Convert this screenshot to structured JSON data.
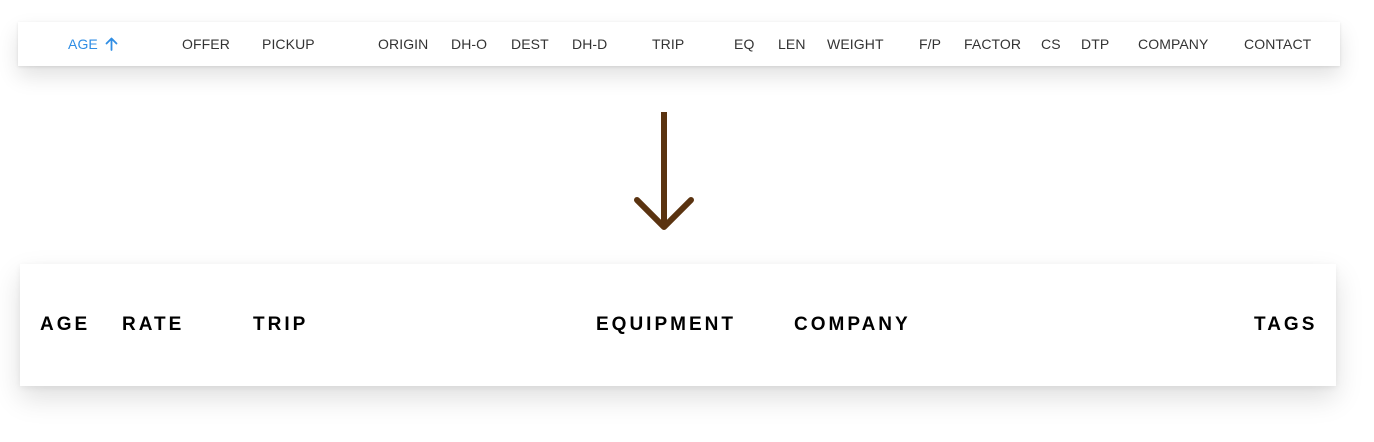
{
  "before_header": {
    "columns": [
      {
        "label": "AGE",
        "active": true,
        "sort": "ascending"
      },
      {
        "label": "OFFER"
      },
      {
        "label": "PICKUP"
      },
      {
        "label": "ORIGIN"
      },
      {
        "label": "DH-O"
      },
      {
        "label": "DEST"
      },
      {
        "label": "DH-D"
      },
      {
        "label": "TRIP"
      },
      {
        "label": "EQ"
      },
      {
        "label": "LEN"
      },
      {
        "label": "WEIGHT"
      },
      {
        "label": "F/P"
      },
      {
        "label": "FACTOR"
      },
      {
        "label": "CS"
      },
      {
        "label": "DTP"
      },
      {
        "label": "COMPANY"
      },
      {
        "label": "CONTACT"
      }
    ],
    "sort_icon": "arrow-up-icon"
  },
  "transition_icon": "arrow-down-icon",
  "after_header": {
    "columns": [
      {
        "label": "AGE"
      },
      {
        "label": "RATE"
      },
      {
        "label": "TRIP"
      },
      {
        "label": "EQUIPMENT"
      },
      {
        "label": "COMPANY"
      },
      {
        "label": "TAGS"
      }
    ]
  },
  "colors": {
    "active_accent": "#2f8de4",
    "header_text": "#333333",
    "new_header_text": "#000000",
    "arrow": "#5a3310"
  }
}
